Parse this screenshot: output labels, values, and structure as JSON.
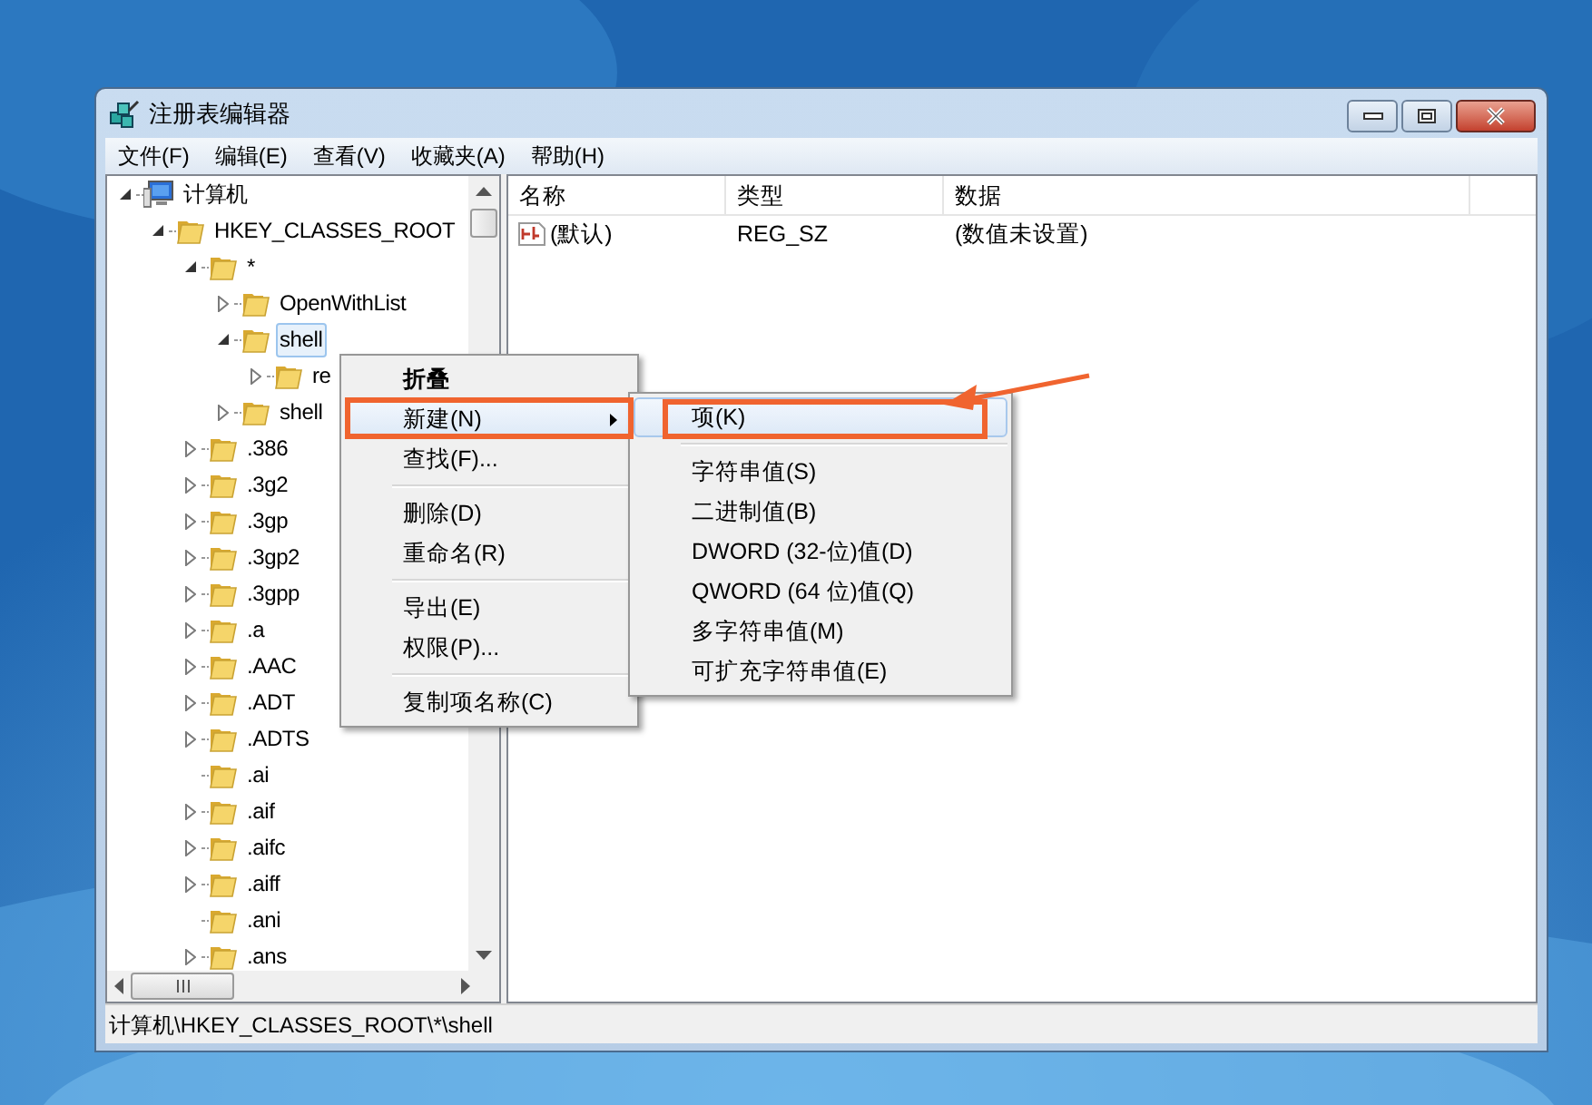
{
  "window": {
    "title": "注册表编辑器"
  },
  "menu_bar": [
    {
      "label": "文件(F)"
    },
    {
      "label": "编辑(E)"
    },
    {
      "label": "查看(V)"
    },
    {
      "label": "收藏夹(A)"
    },
    {
      "label": "帮助(H)"
    }
  ],
  "tree": [
    {
      "label": "计算机",
      "kind": "computer",
      "has_children": true,
      "expanded": true,
      "selected": false,
      "children": [
        {
          "label": "HKEY_CLASSES_ROOT",
          "kind": "folder",
          "has_children": true,
          "expanded": true,
          "selected": false,
          "children": [
            {
              "label": "*",
              "kind": "folder",
              "has_children": true,
              "expanded": true,
              "selected": false,
              "children": [
                {
                  "label": "OpenWithList",
                  "kind": "folder",
                  "has_children": true,
                  "expanded": false,
                  "selected": false
                },
                {
                  "label": "shell",
                  "kind": "folder",
                  "has_children": true,
                  "expanded": true,
                  "selected": true,
                  "children": [
                    {
                      "label": "re",
                      "kind": "folder",
                      "has_children": true,
                      "expanded": false,
                      "selected": false
                    }
                  ]
                },
                {
                  "label": "shell",
                  "kind": "folder",
                  "has_children": true,
                  "expanded": false,
                  "selected": false
                }
              ]
            },
            {
              "label": ".386",
              "kind": "folder",
              "has_children": true,
              "expanded": false,
              "selected": false
            },
            {
              "label": ".3g2",
              "kind": "folder",
              "has_children": true,
              "expanded": false,
              "selected": false
            },
            {
              "label": ".3gp",
              "kind": "folder",
              "has_children": true,
              "expanded": false,
              "selected": false
            },
            {
              "label": ".3gp2",
              "kind": "folder",
              "has_children": true,
              "expanded": false,
              "selected": false
            },
            {
              "label": ".3gpp",
              "kind": "folder",
              "has_children": true,
              "expanded": false,
              "selected": false
            },
            {
              "label": ".a",
              "kind": "folder",
              "has_children": true,
              "expanded": false,
              "selected": false
            },
            {
              "label": ".AAC",
              "kind": "folder",
              "has_children": true,
              "expanded": false,
              "selected": false
            },
            {
              "label": ".ADT",
              "kind": "folder",
              "has_children": true,
              "expanded": false,
              "selected": false
            },
            {
              "label": ".ADTS",
              "kind": "folder",
              "has_children": true,
              "expanded": false,
              "selected": false
            },
            {
              "label": ".ai",
              "kind": "folder",
              "has_children": false,
              "selected": false
            },
            {
              "label": ".aif",
              "kind": "folder",
              "has_children": true,
              "expanded": false,
              "selected": false
            },
            {
              "label": ".aifc",
              "kind": "folder",
              "has_children": true,
              "expanded": false,
              "selected": false
            },
            {
              "label": ".aiff",
              "kind": "folder",
              "has_children": true,
              "expanded": false,
              "selected": false
            },
            {
              "label": ".ani",
              "kind": "folder",
              "has_children": false,
              "selected": false
            },
            {
              "label": ".ans",
              "kind": "folder",
              "has_children": true,
              "expanded": false,
              "selected": false
            }
          ]
        }
      ]
    }
  ],
  "values": {
    "columns": [
      "名称",
      "类型",
      "数据"
    ],
    "rows": [
      {
        "name": "(默认)",
        "type": "REG_SZ",
        "data": "(数值未设置)",
        "kind": "string"
      }
    ]
  },
  "context_menu": [
    {
      "kind": "item",
      "label": "折叠",
      "default": true,
      "selected": false,
      "submenu": false
    },
    {
      "kind": "item",
      "label": "新建(N)",
      "default": false,
      "selected": true,
      "submenu": true
    },
    {
      "kind": "item",
      "label": "查找(F)...",
      "default": false,
      "selected": false,
      "submenu": false
    },
    {
      "kind": "separator"
    },
    {
      "kind": "item",
      "label": "删除(D)",
      "default": false,
      "selected": false,
      "submenu": false
    },
    {
      "kind": "item",
      "label": "重命名(R)",
      "default": false,
      "selected": false,
      "submenu": false
    },
    {
      "kind": "separator"
    },
    {
      "kind": "item",
      "label": "导出(E)",
      "default": false,
      "selected": false,
      "submenu": false
    },
    {
      "kind": "item",
      "label": "权限(P)...",
      "default": false,
      "selected": false,
      "submenu": false
    },
    {
      "kind": "separator"
    },
    {
      "kind": "item",
      "label": "复制项名称(C)",
      "default": false,
      "selected": false,
      "submenu": false
    }
  ],
  "submenu": [
    {
      "kind": "item",
      "label": "项(K)",
      "selected": true
    },
    {
      "kind": "separator"
    },
    {
      "kind": "item",
      "label": "字符串值(S)",
      "selected": false
    },
    {
      "kind": "item",
      "label": "二进制值(B)",
      "selected": false
    },
    {
      "kind": "item",
      "label": "DWORD (32-位)值(D)",
      "selected": false
    },
    {
      "kind": "item",
      "label": "QWORD (64 位)值(Q)",
      "selected": false
    },
    {
      "kind": "item",
      "label": "多字符串值(M)",
      "selected": false
    },
    {
      "kind": "item",
      "label": "可扩充字符串值(E)",
      "selected": false
    }
  ],
  "status_bar": "计算机\\HKEY_CLASSES_ROOT\\*\\shell"
}
